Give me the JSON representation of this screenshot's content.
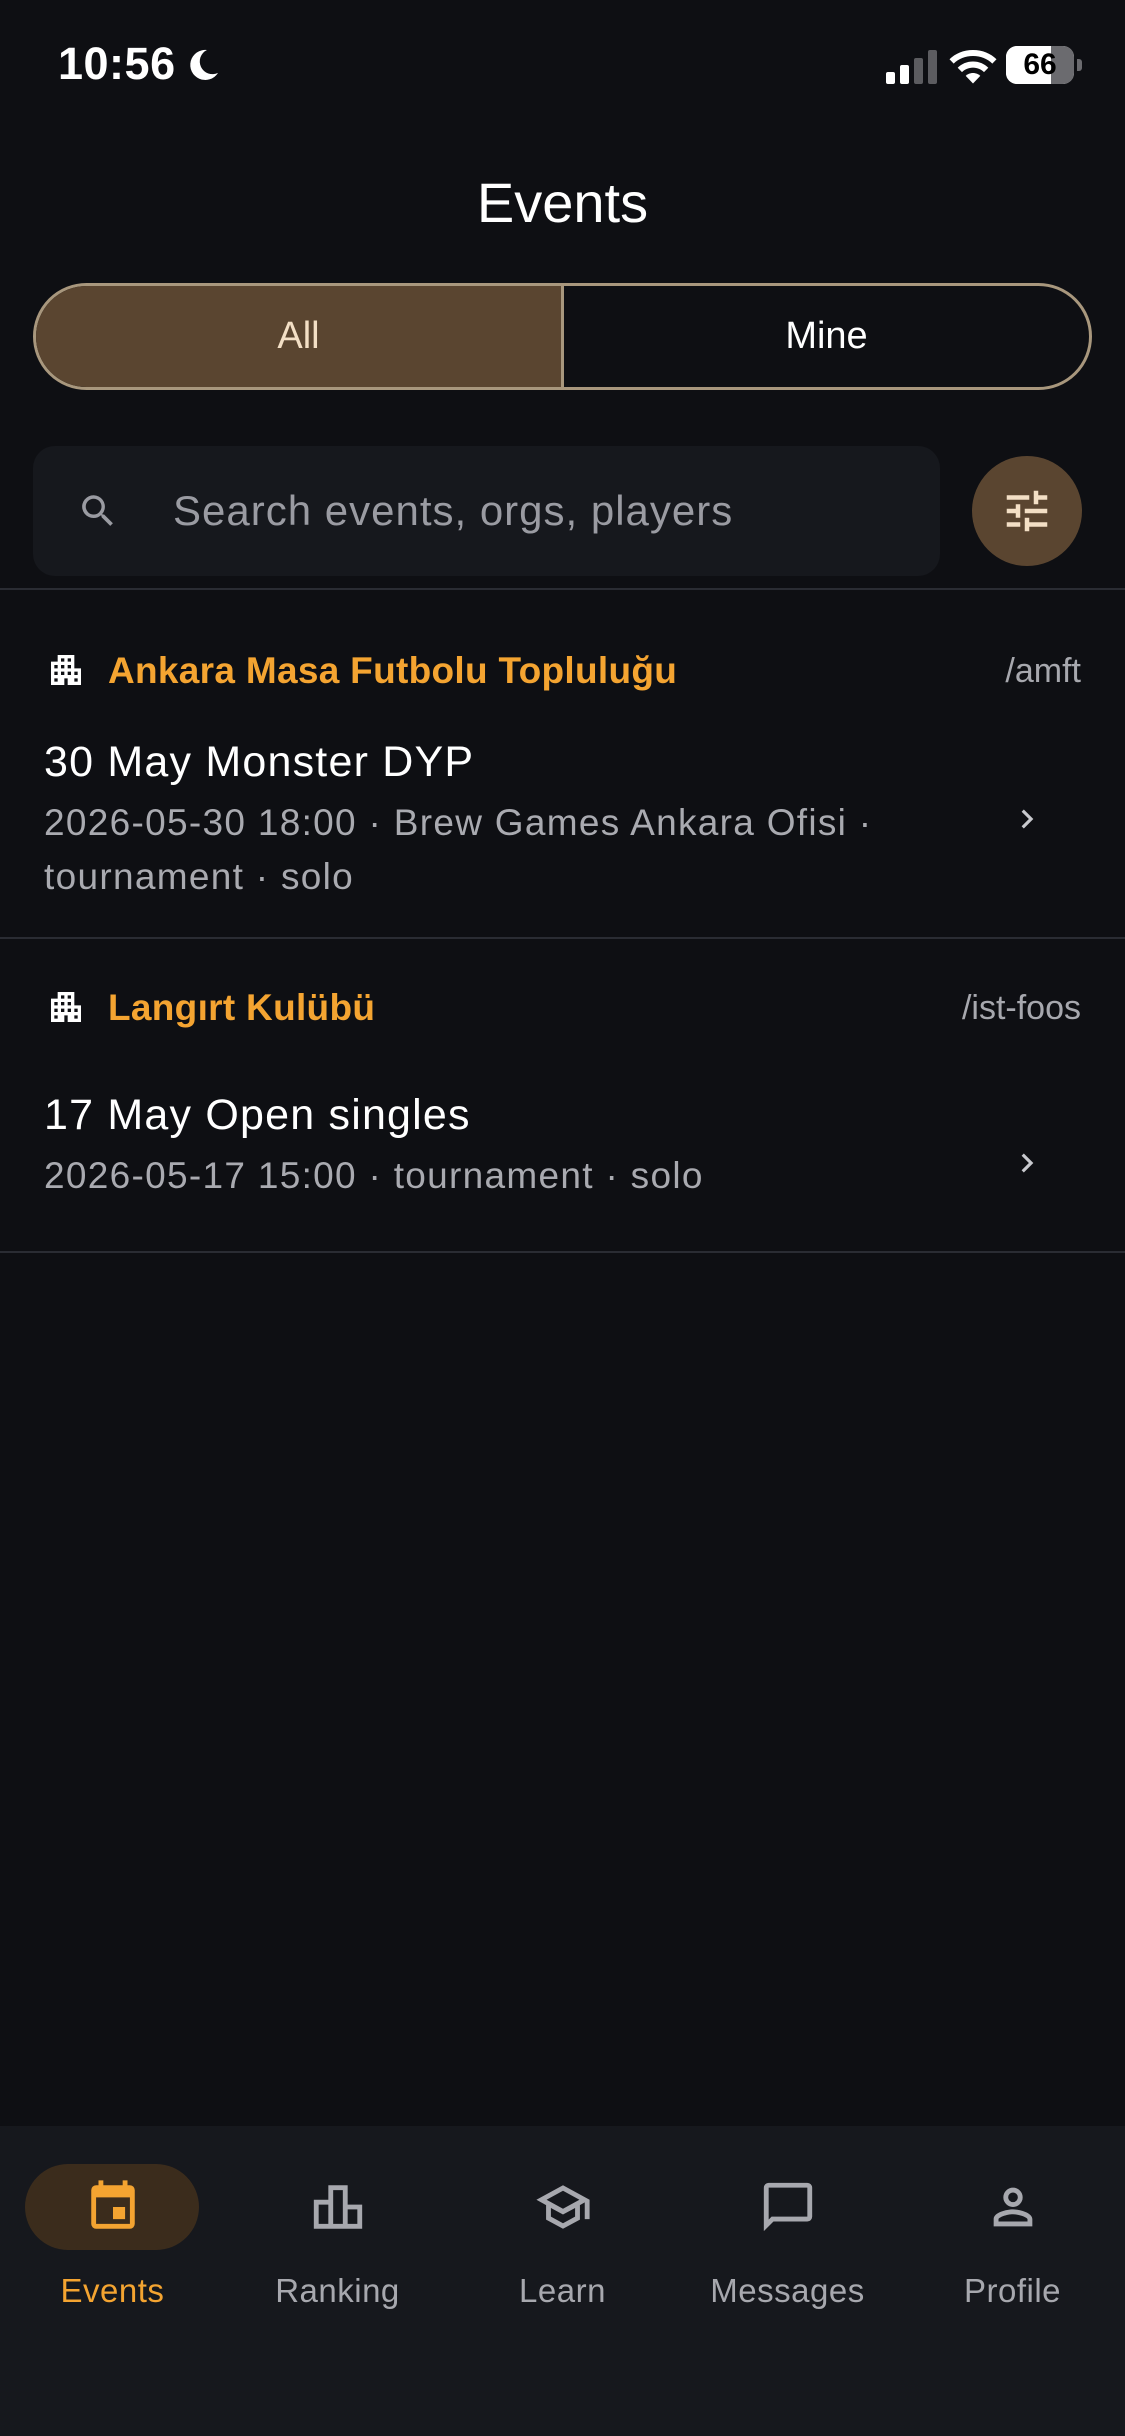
{
  "status_bar": {
    "time": "10:56",
    "battery": "66",
    "battery_level": 0.66
  },
  "header": {
    "title": "Events"
  },
  "segments": {
    "all": "All",
    "mine": "Mine",
    "active": "all"
  },
  "search": {
    "placeholder": "Search events, orgs, players",
    "value": ""
  },
  "groups": [
    {
      "org_name": "Ankara Masa Futbolu Topluluğu",
      "org_slug": "/amft",
      "events": [
        {
          "title": "30 May Monster DYP",
          "meta": "2026-05-30 18:00 · Brew Games Ankara Ofisi · tournament · solo"
        }
      ]
    },
    {
      "org_name": "Langırt Kulübü",
      "org_slug": "/ist-foos",
      "events": [
        {
          "title": "17 May Open singles",
          "meta": "2026-05-17 15:00 · tournament · solo"
        }
      ]
    }
  ],
  "nav": {
    "items": [
      {
        "label": "Events",
        "icon": "calendar-icon",
        "active": true
      },
      {
        "label": "Ranking",
        "icon": "leaderboard-icon",
        "active": false
      },
      {
        "label": "Learn",
        "icon": "school-icon",
        "active": false
      },
      {
        "label": "Messages",
        "icon": "chat-bubble-icon",
        "active": false
      },
      {
        "label": "Profile",
        "icon": "person-icon",
        "active": false
      }
    ]
  },
  "colors": {
    "background": "#0e0f13",
    "accent": "#f4a431",
    "segment_active": "#5a4530",
    "muted_text": "#a9aab0"
  }
}
